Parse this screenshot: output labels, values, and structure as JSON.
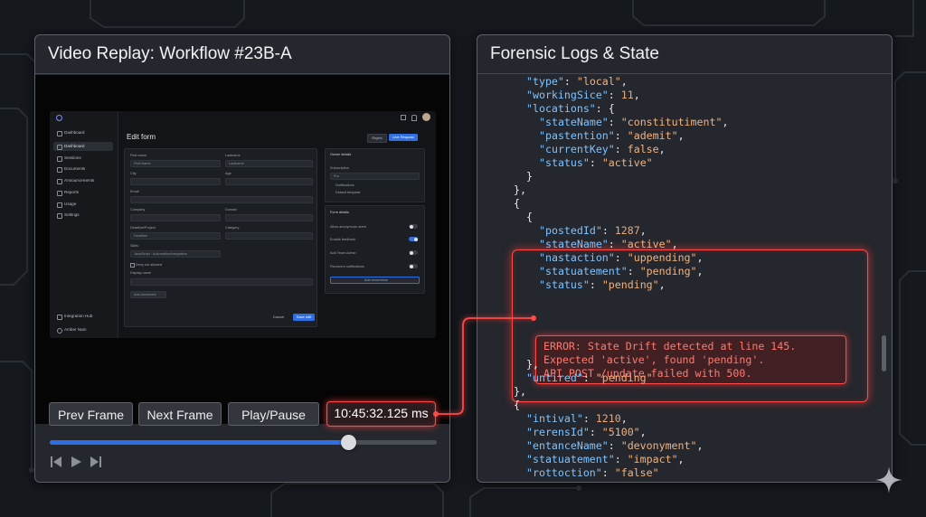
{
  "video_panel": {
    "title": "Video Replay: Workflow #23B-A",
    "controls": {
      "prev_label": "Prev Frame",
      "next_label": "Next Frame",
      "play_label": "Play/Pause",
      "timecode": "10:45:32.125 ms"
    },
    "seek_progress": 0.77,
    "transport_icons": [
      "skip-back-icon",
      "play-icon",
      "skip-forward-icon"
    ]
  },
  "embedded_app": {
    "sidebar_items": [
      "Dashboard",
      "Sessions",
      "Documents",
      "Announcements",
      "Reports",
      "Usage",
      "Settings"
    ],
    "sidebar_workspace": "Dashboard",
    "sidebar_footer": "Integration Hub",
    "user_name": "Amber Nam",
    "page_title": "Edit form",
    "header_buttons": [
      "Reject",
      "Live Request"
    ],
    "fields": {
      "first_name_label": "First name",
      "first_name_placeholder": "First Name",
      "last_name_label": "Lastname",
      "last_name_placeholder": "Lastname",
      "city_label": "City",
      "age_label": "Age",
      "email_label": "Email",
      "company_label": "Company",
      "domain_label": "Domain",
      "status_label": "Deadline/Project",
      "status_value": "Deadline",
      "category_label": "Category",
      "tags_label": "Skills",
      "tag_1": "JavaScript",
      "tag_2": "Automation/Integration",
      "checkbox_label": "Deny not allowed",
      "display_name_label": "Display name",
      "add_button": "Add document"
    },
    "footer_buttons": [
      "Cancel",
      "Save edit"
    ],
    "side_card_1": {
      "title": "Owner details",
      "field_label": "Subscription",
      "field_value": "Pro",
      "check_1": "Notifications",
      "check_2": "Default template"
    },
    "side_card_2": {
      "title": "Form details",
      "toggles": [
        {
          "label": "Allow anonymous users",
          "on": false
        },
        {
          "label": "Enable feedback",
          "on": true
        },
        {
          "label": "Add Team Admin",
          "on": false
        },
        {
          "label": "Recurrent notifications",
          "on": false
        }
      ],
      "button": "Add recurrence"
    }
  },
  "log_panel": {
    "title": "Forensic Logs & State",
    "lines": [
      {
        "i": 4,
        "k": "\"type\"",
        "v": "\"local\"",
        "t": "s",
        "e": ","
      },
      {
        "i": 4,
        "k": "\"workingSice\"",
        "v": "11",
        "t": "n",
        "e": ","
      },
      {
        "i": 4,
        "k": "\"locations\"",
        "v": "{",
        "t": "p",
        "e": ""
      },
      {
        "i": 6,
        "k": "\"stateName\"",
        "v": "\"constitutiment\"",
        "t": "s",
        "e": ","
      },
      {
        "i": 6,
        "k": "\"pastention\"",
        "v": "\"ademit\"",
        "t": "s",
        "e": ","
      },
      {
        "i": 6,
        "k": "\"currentKey\"",
        "v": "false",
        "t": "s",
        "e": ","
      },
      {
        "i": 6,
        "k": "\"status\"",
        "v": "\"active\"",
        "t": "s",
        "e": ""
      },
      {
        "i": 4,
        "k": "",
        "v": "}",
        "t": "p",
        "e": ""
      },
      {
        "i": 2,
        "k": "",
        "v": "},",
        "t": "p",
        "e": ""
      },
      {
        "i": 2,
        "k": "",
        "v": "{",
        "t": "p",
        "e": ""
      },
      {
        "i": 4,
        "k": "",
        "v": "{",
        "t": "p",
        "e": ""
      },
      {
        "i": 6,
        "k": "\"postedId\"",
        "v": "1287",
        "t": "n",
        "e": ","
      },
      {
        "i": 6,
        "k": "\"stateName\"",
        "v": "\"active\"",
        "t": "s",
        "e": ","
      },
      {
        "i": 6,
        "k": "\"nastaction\"",
        "v": "\"uppending\"",
        "t": "s",
        "e": ","
      },
      {
        "i": 6,
        "k": "\"statuatement\"",
        "v": "\"pending\"",
        "t": "s",
        "e": ","
      },
      {
        "i": 6,
        "k": "\"status\"",
        "v": "\"pending\"",
        "t": "s",
        "e": ","
      },
      {
        "i": 4,
        "k": "",
        "v": "},",
        "t": "p",
        "e": ""
      },
      {
        "i": 4,
        "k": "\"untired\"",
        "v": "\"pending\"",
        "t": "s",
        "e": ""
      },
      {
        "i": 2,
        "k": "",
        "v": "},",
        "t": "p",
        "e": ""
      },
      {
        "i": 2,
        "k": "",
        "v": "{",
        "t": "p",
        "e": ""
      },
      {
        "i": 4,
        "k": "\"intival\"",
        "v": "1210",
        "t": "n",
        "e": ","
      },
      {
        "i": 4,
        "k": "\"rerensId\"",
        "v": "\"5100\"",
        "t": "s",
        "e": ","
      },
      {
        "i": 4,
        "k": "\"entanceName\"",
        "v": "\"devonyment\"",
        "t": "s",
        "e": ","
      },
      {
        "i": 4,
        "k": "\"statuatement\"",
        "v": "\"impact\"",
        "t": "s",
        "e": ","
      },
      {
        "i": 4,
        "k": "\"rottoction\"",
        "v": "\"false\"",
        "t": "s",
        "e": ""
      }
    ],
    "error": {
      "line1": "ERROR: State Drift detected at line 145.",
      "line2": "Expected 'active', found 'pending'.",
      "line3": "API POST /update failed with 500."
    }
  },
  "colors": {
    "accent": "#2f6fe4",
    "alert": "#ff4a4a",
    "key": "#7fc3ff",
    "string": "#f2b37f"
  }
}
